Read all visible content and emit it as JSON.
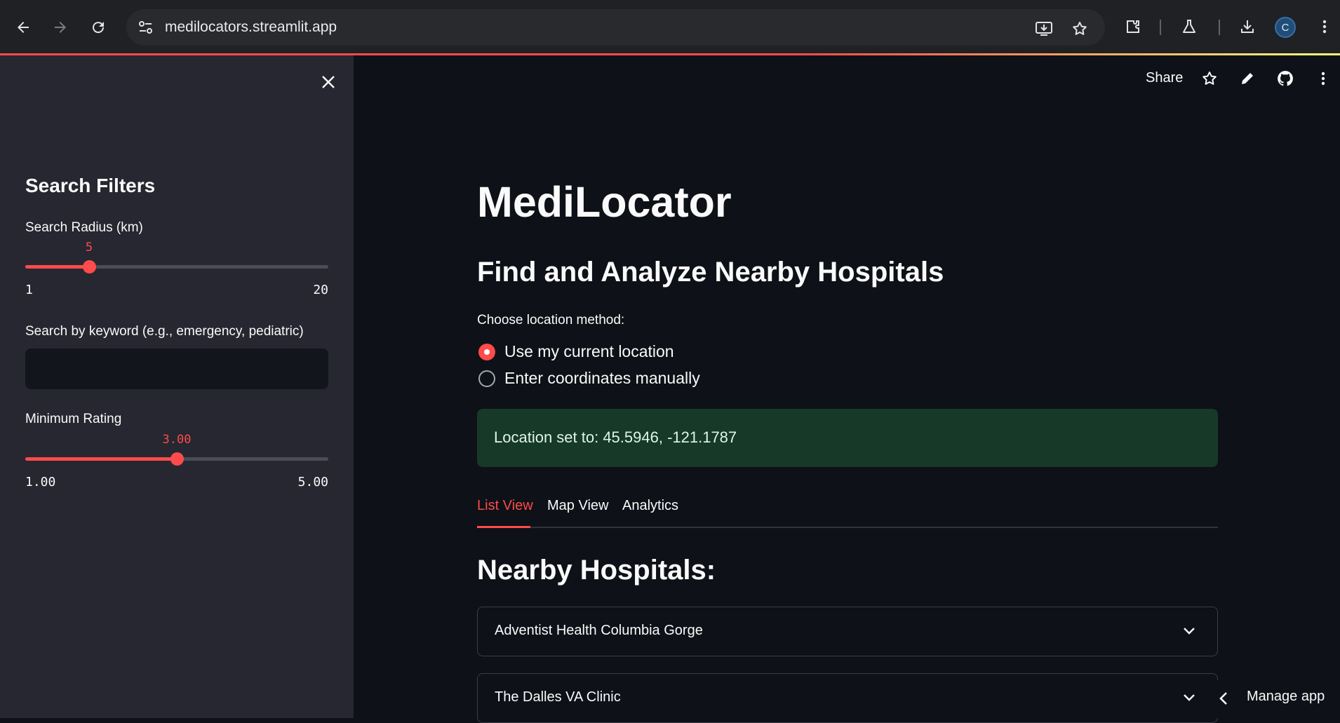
{
  "browser": {
    "url": "medilocators.streamlit.app",
    "profile_initial": "C"
  },
  "sidebar": {
    "title": "Search Filters",
    "radius": {
      "label": "Search Radius (km)",
      "value": "5",
      "min": "1",
      "max": "20",
      "fraction": 0.2105
    },
    "keyword": {
      "label": "Search by keyword (e.g., emergency, pediatric)",
      "value": "",
      "placeholder": ""
    },
    "rating": {
      "label": "Minimum Rating",
      "value": "3.00",
      "min": "1.00",
      "max": "5.00",
      "fraction": 0.5
    }
  },
  "header": {
    "share_label": "Share"
  },
  "main": {
    "title": "MediLocator",
    "subtitle": "Find and Analyze Nearby Hospitals",
    "location_method": {
      "label": "Choose location method:",
      "options": [
        "Use my current location",
        "Enter coordinates manually"
      ],
      "selected": 0
    },
    "alert_text": "Location set to: 45.5946, -121.1787",
    "tabs": [
      "List View",
      "Map View",
      "Analytics"
    ],
    "active_tab": 0,
    "section_title": "Nearby Hospitals:",
    "hospitals": [
      "Adventist Health Columbia Gorge",
      "The Dalles VA Clinic"
    ]
  },
  "manage_app_label": "Manage app",
  "colors": {
    "accent": "#ff4b4b",
    "background": "#0e1117",
    "sidebar": "#262730",
    "success_bg": "#173928"
  }
}
